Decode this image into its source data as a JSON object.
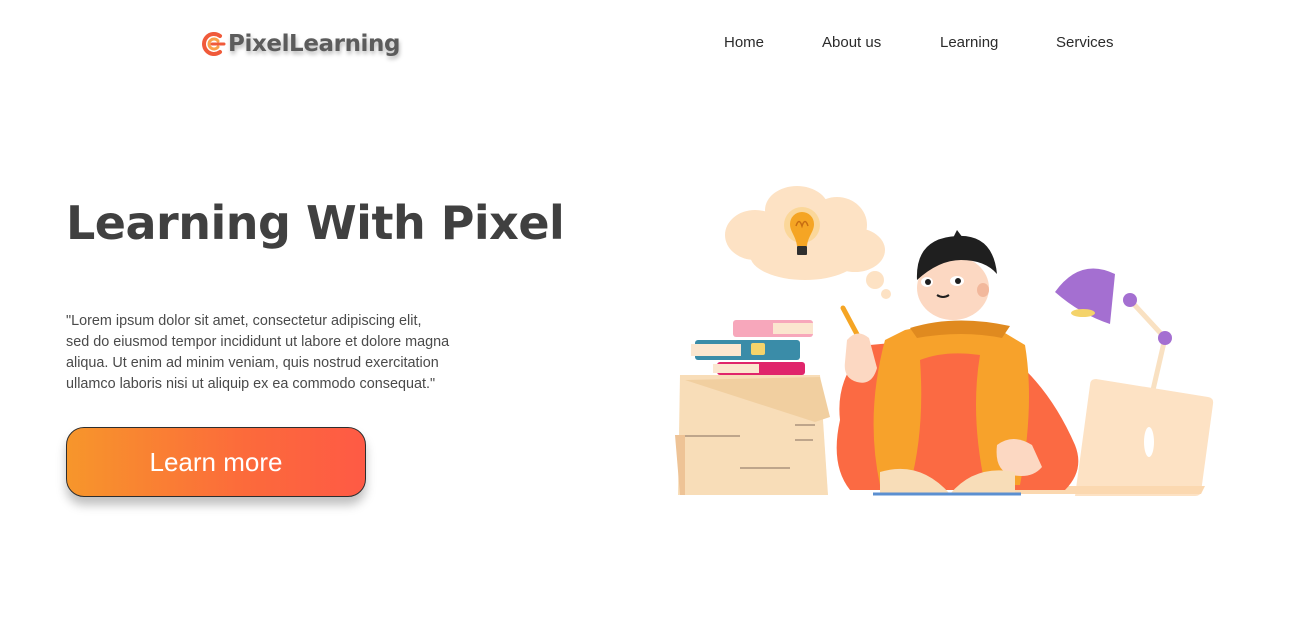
{
  "header": {
    "logo_text": "PixelLearning",
    "logo_icon": "pixel-c-logo-icon",
    "brand_colors": [
      "#f05a3a",
      "#f9a04a"
    ]
  },
  "nav": {
    "items": [
      {
        "label": "Home"
      },
      {
        "label": "About us"
      },
      {
        "label": "Learning"
      },
      {
        "label": "Services"
      }
    ]
  },
  "hero": {
    "title": "Learning With Pixel",
    "description_lines": [
      "\"Lorem ipsum dolor sit amet, consectetur adipiscing elit,",
      "sed do eiusmod tempor incididunt ut labore et dolore magna",
      "aliqua. Ut enim ad minim veniam, quis nostrud exercitation",
      "ullamco laboris nisi ut aliquip ex ea commodo consequat.\""
    ],
    "cta_label": "Learn more",
    "cta_gradient": [
      "#f7962b",
      "#fe5a45"
    ],
    "illustration": "student-studying-illustration"
  }
}
